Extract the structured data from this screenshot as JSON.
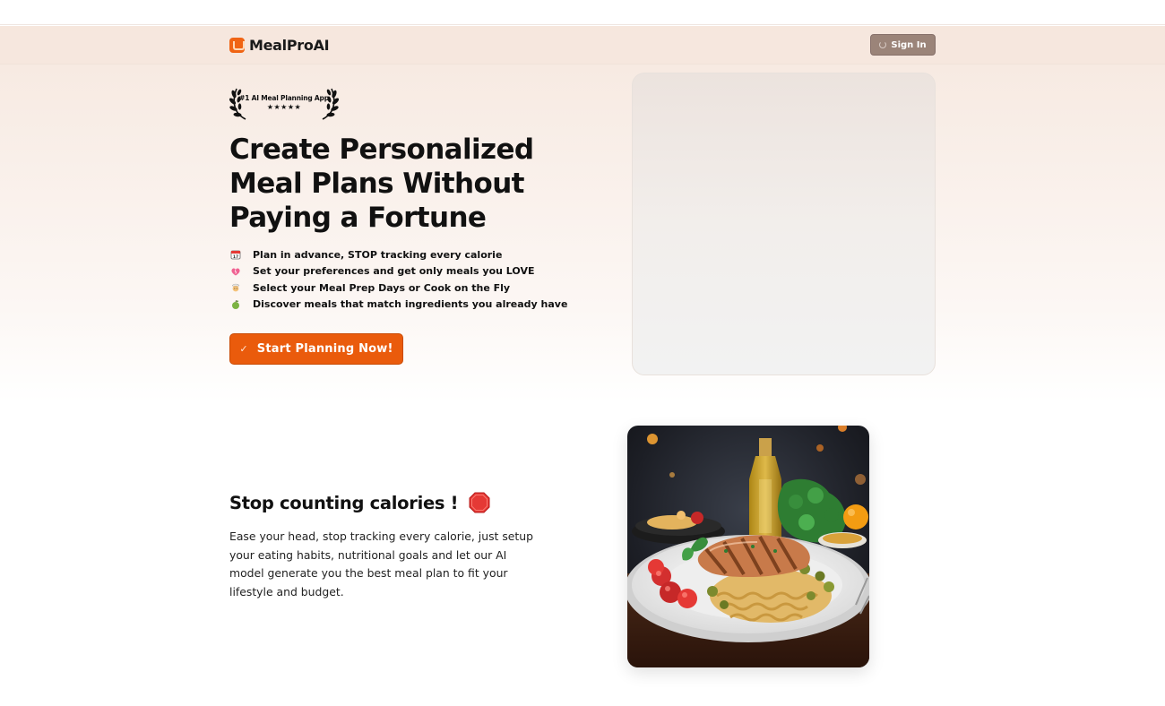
{
  "app": {
    "name": "MealProAI"
  },
  "header": {
    "signin_label": "Sign In"
  },
  "hero": {
    "badge": {
      "title": "#1 AI Meal Planning App",
      "stars": "★★★★★",
      "rating": 5
    },
    "headline": "Create Personalized Meal Plans Without Paying a Fortune",
    "features": [
      {
        "icon": "calendar-icon",
        "text": "Plan in advance, STOP tracking every calorie"
      },
      {
        "icon": "heart-icon",
        "text": "Set your preferences and get only meals you LOVE"
      },
      {
        "icon": "cook-icon",
        "text": "Select your Meal Prep Days or Cook on the Fly"
      },
      {
        "icon": "apple-icon",
        "text": "Discover meals that match ingredients you already have"
      }
    ],
    "cta_label": "Start Planning Now!"
  },
  "section": {
    "title": "Stop counting calories !",
    "body": "Ease your head, stop tracking every calorie, just setup your eating habits, nutritional goals and let our AI model generate you the best meal plan to fit your lifestyle and budget."
  },
  "colors": {
    "accent": "#ea5b0c",
    "signin": "#9b8479",
    "heroTint": "#f6e8df"
  }
}
